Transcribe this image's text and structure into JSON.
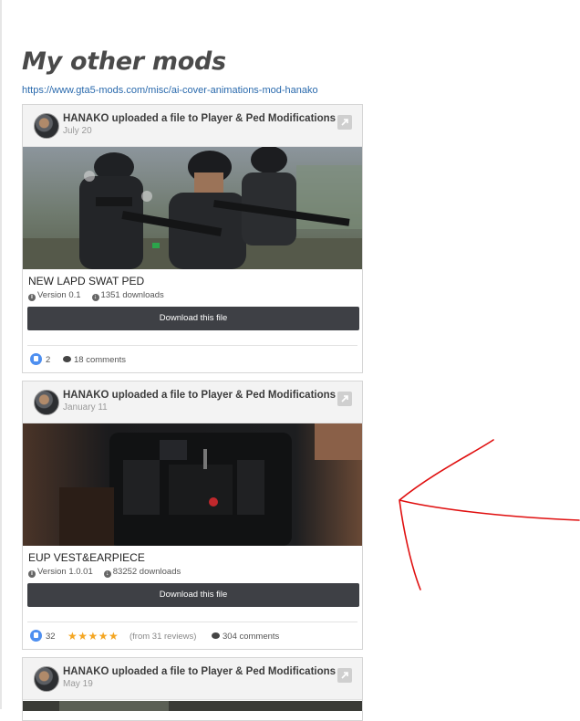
{
  "page": {
    "title": "My other mods",
    "link": "https://www.gta5-mods.com/misc/ai-cover-animations-mod-hanako"
  },
  "cards": [
    {
      "header": "HANAKO uploaded a file to Player & Ped Modifications",
      "date": "July 20",
      "name": "NEW LAPD SWAT PED",
      "version": "Version 0.1",
      "downloads": "1351 downloads",
      "download_label": "Download this file",
      "likes": "2",
      "comments": "18 comments",
      "rating_stars": "",
      "reviews": ""
    },
    {
      "header": "HANAKO uploaded a file to Player & Ped Modifications",
      "date": "January 11",
      "name": "EUP VEST&EARPIECE",
      "version": "Version 1.0.01",
      "downloads": "83252 downloads",
      "download_label": "Download this file",
      "likes": "32",
      "comments": "304 comments",
      "rating_stars": "★★★★★",
      "reviews": "(from 31 reviews)"
    },
    {
      "header": "HANAKO uploaded a file to Player & Ped Modifications",
      "date": "May 19"
    }
  ],
  "icons": {
    "expand": "expand-icon",
    "info": "info-icon",
    "download": "download-circle-icon",
    "like": "thumbs-up-icon",
    "comment": "comment-icon"
  },
  "colors": {
    "button": "#3e4045",
    "accent": "#4e8ff0",
    "star": "#f4a623",
    "annotation": "#e01010"
  }
}
